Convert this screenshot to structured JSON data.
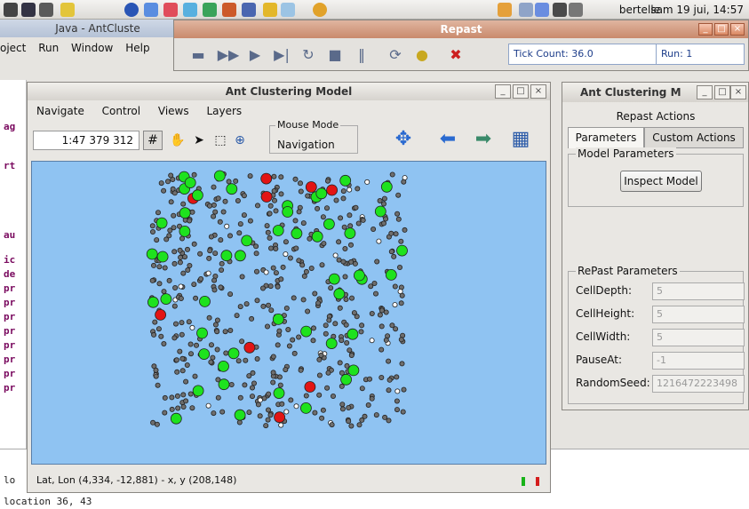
{
  "panel": {
    "user": "bertelle",
    "clock": "sam 19 jui, 14:57"
  },
  "eclipse": {
    "title": "Java - AntCluste",
    "menu": [
      "oject",
      "Run",
      "Window",
      "Help"
    ],
    "code_frags": [
      "ag",
      "rt",
      "au",
      "ic",
      "de",
      "pr",
      "pr",
      "pr",
      "pr",
      "pr",
      "pr",
      "pr",
      "pr"
    ],
    "console": [
      "lo",
      "location 36, 43"
    ]
  },
  "repast": {
    "title": "Repast",
    "tick_count": "Tick Count: 36.0",
    "run": "Run: 1"
  },
  "ant_window": {
    "title": "Ant Clustering Model",
    "menu": [
      "Navigate",
      "Control",
      "Views",
      "Layers"
    ],
    "zoom": "1:47 379 312",
    "mouse_mode_label": "Mouse Mode",
    "mouse_mode_value": "Navigation",
    "status": "Lat, Lon (4,334, -12,881) - x, y (208,148)"
  },
  "params_window": {
    "title": "Ant Clustering M",
    "repast_actions": "Repast Actions",
    "tab_parameters": "Parameters",
    "tab_custom": "Custom Actions",
    "model_params_label": "Model Parameters",
    "inspect_button": "Inspect Model",
    "repast_params_label": "RePast Parameters",
    "rows": [
      {
        "label": "CellDepth:",
        "value": "5"
      },
      {
        "label": "CellHeight:",
        "value": "5"
      },
      {
        "label": "CellWidth:",
        "value": "5"
      },
      {
        "label": "PauseAt:",
        "value": "-1"
      },
      {
        "label": "RandomSeed:",
        "value": "1216472223498"
      }
    ]
  },
  "colors": {
    "canvas_bg": "#8fc3f2",
    "ant_green": "#1ee21e",
    "ant_red": "#e21414",
    "cell_grey": "#6e6e6e"
  }
}
